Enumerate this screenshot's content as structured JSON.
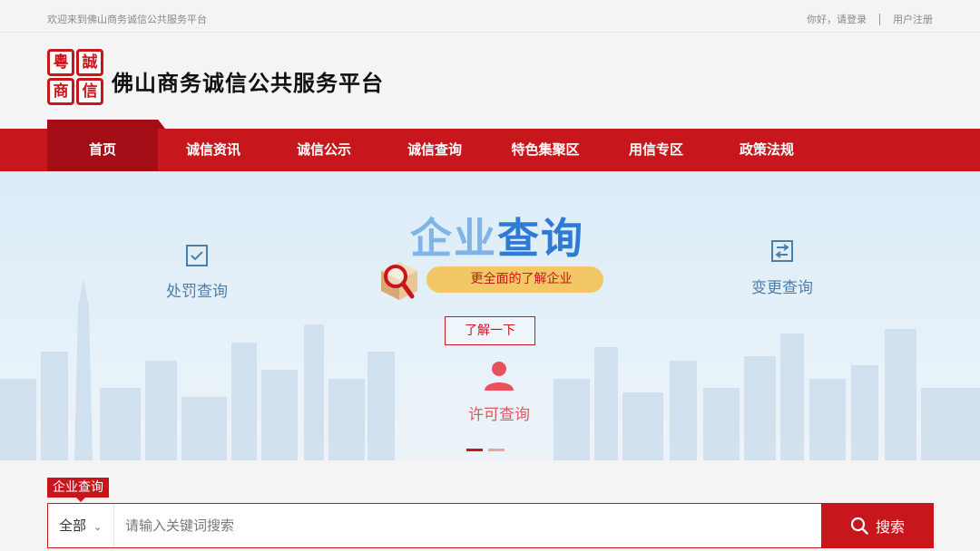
{
  "topbar": {
    "welcome": "欢迎来到佛山商务诚信公共服务平台",
    "login": "你好，请登录",
    "register": "用户注册"
  },
  "header": {
    "logo_chars": [
      "粵",
      "誠",
      "商",
      "信"
    ],
    "title": "佛山商务诚信公共服务平台"
  },
  "nav": {
    "items": [
      {
        "label": "首页",
        "active": true
      },
      {
        "label": "诚信资讯"
      },
      {
        "label": "诚信公示"
      },
      {
        "label": "诚信查询"
      },
      {
        "label": "特色集聚区"
      },
      {
        "label": "用信专区"
      },
      {
        "label": "政策法规"
      }
    ]
  },
  "banner": {
    "title_light": "企业",
    "title_dark": "查询",
    "slogan": "更全面的了解企业",
    "learn_more": "了解一下",
    "punish": "处罚查询",
    "change": "变更查询",
    "license": "许可查询",
    "slide_index": 1,
    "slide_count": 2
  },
  "search": {
    "tag": "企业查询",
    "scope": "全部",
    "placeholder": "请输入关键词搜索",
    "button": "搜索"
  },
  "colors": {
    "brand_red": "#c8161d",
    "nav_active": "#a50d16",
    "banner_blue": "#2f7bd3",
    "slogan_gold": "#f2c766"
  }
}
